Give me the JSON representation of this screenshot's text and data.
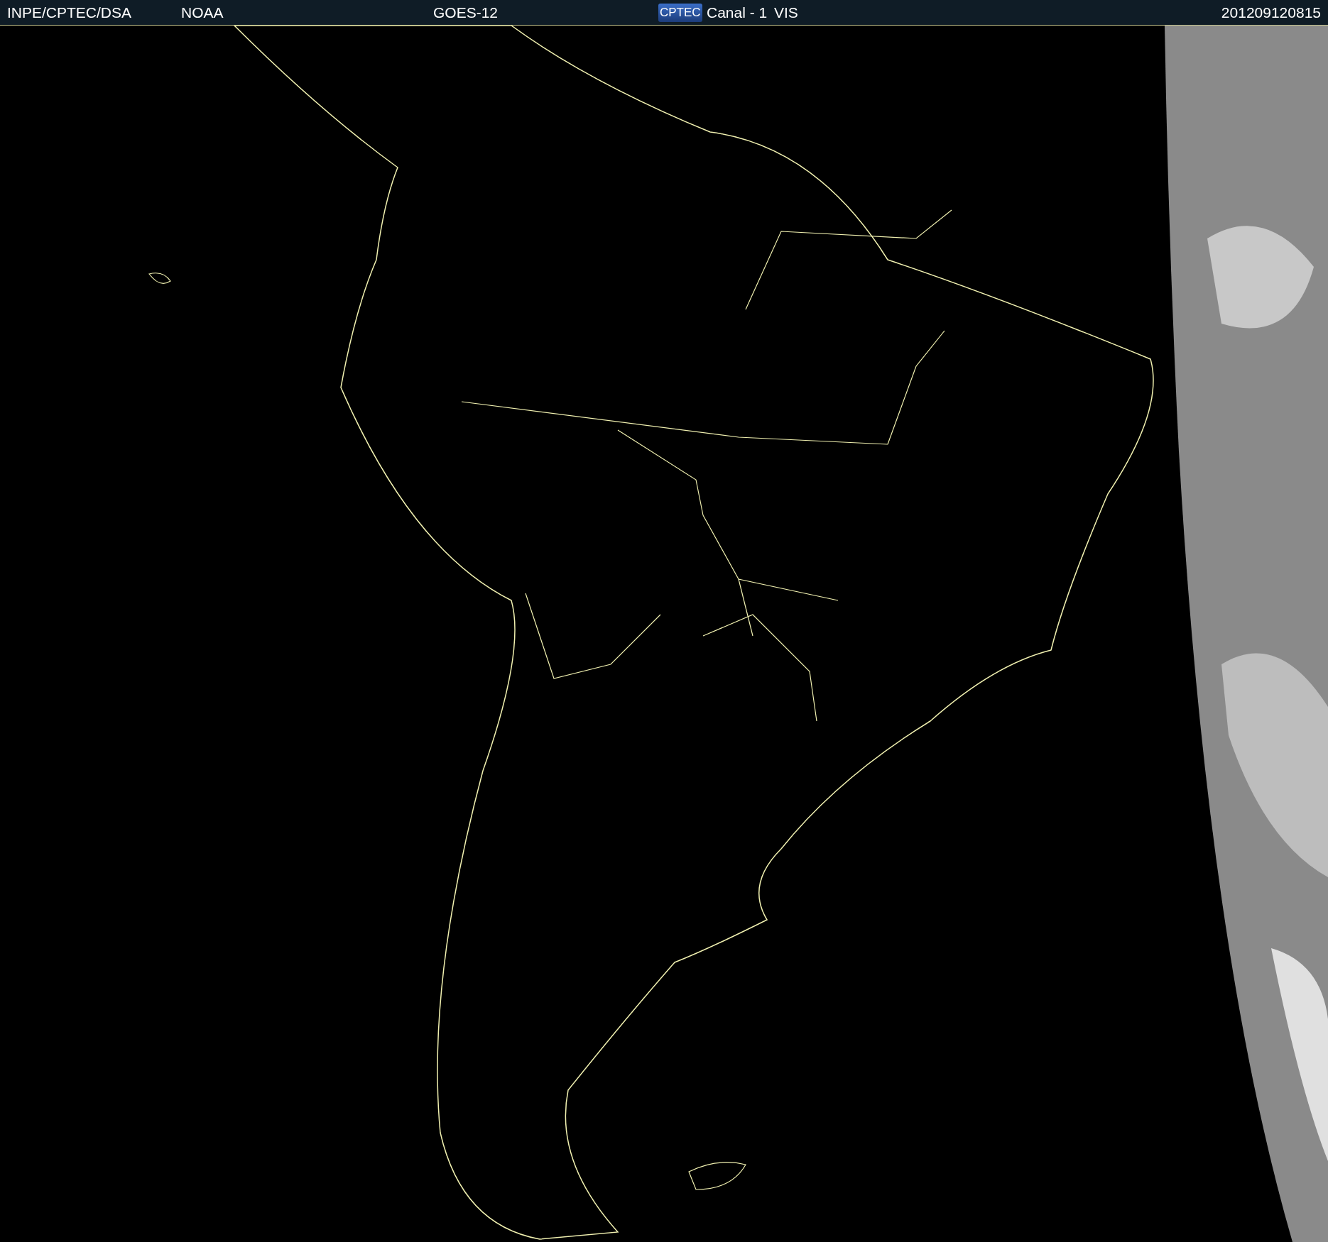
{
  "header": {
    "source": "INPE/CPTEC/DSA",
    "agency": "NOAA",
    "satellite": "GOES-12",
    "logo": "CPTEC",
    "channel": "Canal - 1",
    "band": "VIS",
    "timestamp": "201209120815"
  }
}
